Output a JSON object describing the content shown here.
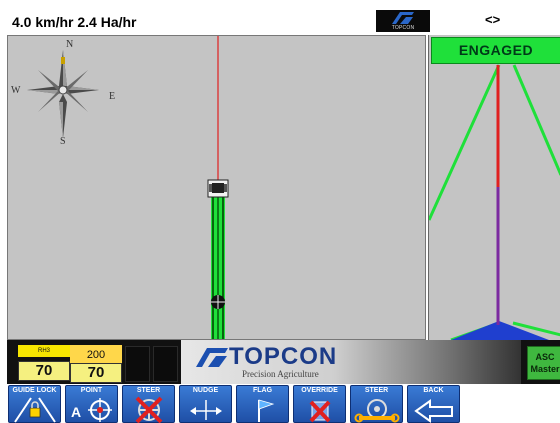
{
  "status": {
    "speed_area": "4.0 km/hr  2.4 Ha/hr",
    "logo_caption": "TOPCON",
    "nav_arrows": "<>"
  },
  "compass": {
    "north": "N",
    "south": "S",
    "east": "E",
    "west": "W"
  },
  "steer": {
    "state": "ENGAGED"
  },
  "gauges": [
    {
      "label": "RH3",
      "value": "70"
    },
    {
      "label": "200",
      "value": "70"
    }
  ],
  "brand": {
    "name": "TOPCON",
    "tagline": "Precision Agriculture"
  },
  "asc": {
    "line1": "ASC",
    "line2": "Master"
  },
  "buttons": [
    {
      "label": "GUIDE LOCK"
    },
    {
      "label": "POINT"
    },
    {
      "label": "STEER"
    },
    {
      "label": "NUDGE"
    },
    {
      "label": "FLAG"
    },
    {
      "label": "OVERRIDE"
    },
    {
      "label": "STEER"
    },
    {
      "label": "BACK"
    }
  ],
  "point_letter": "A",
  "colors": {
    "map_bg": "#c4c4c4",
    "engaged_green": "#1fe03a",
    "guide_line_red": "#e02020",
    "swath_green": "#1fe03a",
    "button_blue": "#2a63c0"
  }
}
